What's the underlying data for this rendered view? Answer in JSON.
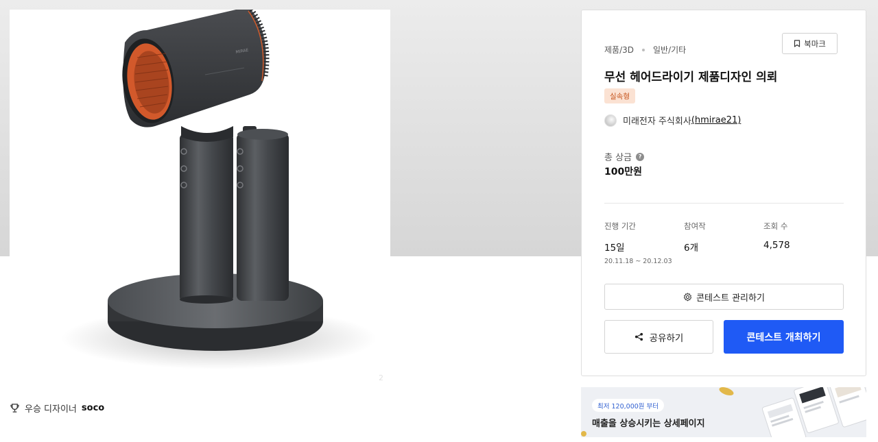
{
  "product_image": {
    "product_brand_text": "MIRAE",
    "page_mark": "2"
  },
  "winner": {
    "label": "우승 디자이너",
    "name": "soco"
  },
  "panel": {
    "breadcrumb": [
      "제품/3D",
      "일반/기타"
    ],
    "bookmark_label": "북마크",
    "title": "무선 헤어드라이기 제품디자인 의뢰",
    "tag": "실속형",
    "company_name": "미래전자 주식회사",
    "company_handle": "(hmirae21)",
    "prize_label": "총 상금",
    "prize_help": "?",
    "prize_value": "100만원",
    "stats": {
      "period_label": "진행 기간",
      "period_value": "15일",
      "period_range": "20.11.18  ~  20.12.03",
      "entries_label": "참여작",
      "entries_value": "6개",
      "views_label": "조회 수",
      "views_value": "4,578"
    },
    "manage_label": "콘테스트 관리하기",
    "share_label": "공유하기",
    "host_label": "콘테스트 개최하기"
  },
  "banner": {
    "pill": "최저 120,000원 부터",
    "headline": "매출을 상승시키는 상세페이지"
  },
  "colors": {
    "primary_button": "#1f5af5",
    "tag_bg": "#fbe2d3",
    "tag_text": "#c5531b",
    "dryer_accent": "#d2592b",
    "dryer_body": "#3b3d40"
  },
  "icons": {
    "bookmark": "bookmark-icon",
    "gear": "gear-icon",
    "share": "share-icon",
    "trophy": "trophy-icon",
    "help": "help-icon"
  }
}
